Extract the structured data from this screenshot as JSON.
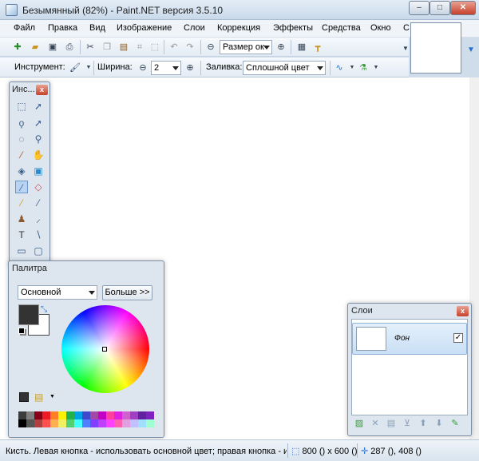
{
  "window": {
    "title": "Безымянный (82%) - Paint.NET версия 3.5.10",
    "minimize": "–",
    "maximize": "□",
    "close": "✕"
  },
  "menu": [
    "Файл",
    "Правка",
    "Вид",
    "Изображение",
    "Слои",
    "Коррекция",
    "Эффекты",
    "Средства",
    "Окно",
    "С"
  ],
  "toolbar": {
    "zoom_combo": "Размер ок",
    "icons": [
      "new-icon",
      "open-icon",
      "save-icon",
      "print-icon",
      "cut-icon",
      "copy-icon",
      "paste-icon",
      "crop-icon",
      "deselect-icon",
      "undo-icon",
      "redo-icon",
      "zoom-out-icon",
      "zoom-in-icon",
      "grid-icon",
      "ruler-icon"
    ]
  },
  "toolbar2": {
    "tool_label": "Инструмент:",
    "width_label": "Ширина:",
    "width_value": "2",
    "minus": "⊖",
    "plus": "⊕",
    "fill_label": "Заливка:",
    "fill_value": "Сплошной цвет"
  },
  "tools_panel": {
    "title": "Инс...",
    "tools": [
      "select-rect",
      "move-selection",
      "lasso",
      "move",
      "ellipse-select",
      "zoom",
      "magic-wand",
      "pan",
      "paint-bucket",
      "gradient",
      "paintbrush",
      "eraser",
      "pencil",
      "color-picker",
      "clone-stamp",
      "recolor",
      "text",
      "line-curve",
      "rectangle",
      "rounded-rect"
    ]
  },
  "palette_panel": {
    "title": "Палитра",
    "mode": "Основной",
    "more_button": "Больше >>",
    "primary_color": "#333333",
    "secondary_color": "#ffffff"
  },
  "palette_colors": {
    "row1": [
      "#3c3c3c",
      "#7f7f7f",
      "#880015",
      "#ed1c24",
      "#ff7f27",
      "#fff200",
      "#22b14c",
      "#00a2e8",
      "#3f48cc",
      "#a349a4",
      "#c400c4",
      "#ff3fa0",
      "#e020e0",
      "#d060d0",
      "#a040c0",
      "#6020a0",
      "#8020c0"
    ],
    "row2": [
      "#000000",
      "#555555",
      "#b04040",
      "#ff5050",
      "#ffb050",
      "#f0f060",
      "#50d070",
      "#40ffff",
      "#5080ff",
      "#8040ff",
      "#c040ff",
      "#ff40ff",
      "#ff60b0",
      "#e0a0e0",
      "#c0c0ff",
      "#a0e0ff",
      "#a0ffd0"
    ]
  },
  "layers_panel": {
    "title": "Слои",
    "layer_name": "Фон",
    "checked": "✓",
    "buttons": [
      "add-layer-icon",
      "delete-layer-icon",
      "duplicate-layer-icon",
      "merge-layer-down-icon",
      "move-up-icon",
      "move-down-icon",
      "layer-properties-icon"
    ]
  },
  "status": {
    "text": "Кисть. Левая кнопка - использовать основной цвет; правая кнопка - и",
    "size": "800 () x 600 ()",
    "position": "287 (), 408 ()"
  }
}
